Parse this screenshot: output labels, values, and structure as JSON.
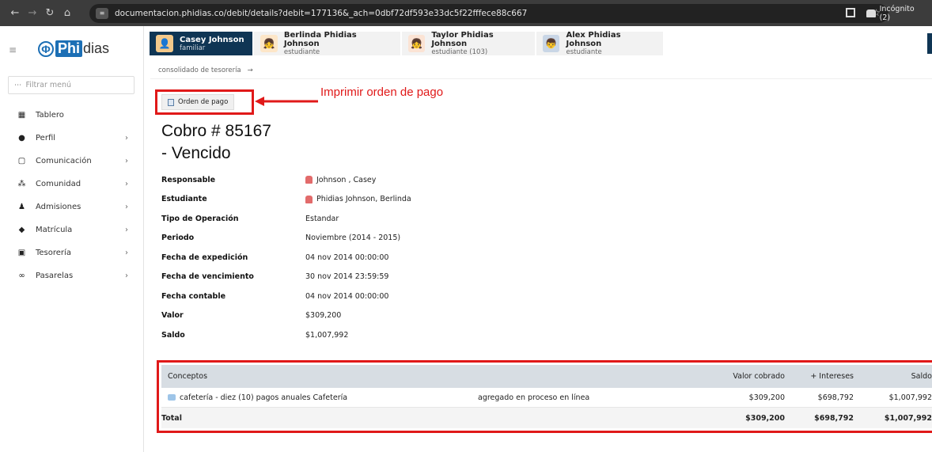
{
  "browser": {
    "url": "documentacion.phidias.co/debit/details?debit=177136&_ach=0dbf72df593e33dc5f22fffece88c667",
    "incognito_label": "Incógnito (2)"
  },
  "sidebar": {
    "logo": {
      "phi": "Phi",
      "dias": "dias"
    },
    "filter_placeholder": "Filtrar menú",
    "items": [
      {
        "label": "Tablero",
        "icon": "dashboard-icon"
      },
      {
        "label": "Perfil",
        "icon": "person-icon"
      },
      {
        "label": "Comunicación",
        "icon": "chat-icon"
      },
      {
        "label": "Comunidad",
        "icon": "group-icon"
      },
      {
        "label": "Admisiones",
        "icon": "admissions-icon"
      },
      {
        "label": "Matrícula",
        "icon": "graduation-cap-icon"
      },
      {
        "label": "Tesorería",
        "icon": "money-icon"
      },
      {
        "label": "Pasarelas",
        "icon": "link-icon"
      }
    ]
  },
  "tabs": [
    {
      "name": "Casey Johnson",
      "role": "familiar"
    },
    {
      "name": "Berlinda Phidias Johnson",
      "role": "estudiante"
    },
    {
      "name": "Taylor Phidias Johnson",
      "role": "estudiante (103)"
    },
    {
      "name": "Alex Phidias Johnson",
      "role": "estudiante"
    }
  ],
  "breadcrumb": {
    "label": "consolidado de tesorería",
    "arrow": "→"
  },
  "orden_button": "Orden de pago",
  "annotation": "Imprimir orden de pago",
  "title": {
    "line1": "Cobro # 85167",
    "line2": "- Vencido"
  },
  "details": [
    {
      "key": "Responsable",
      "value": "Johnson , Casey",
      "person": true
    },
    {
      "key": "Estudiante",
      "value": "Phidias Johnson, Berlinda",
      "person": true
    },
    {
      "key": "Tipo de Operación",
      "value": "Estandar"
    },
    {
      "key": "Periodo",
      "value": "Noviembre (2014 - 2015)"
    },
    {
      "key": "Fecha de expedición",
      "value": "04 nov 2014 00:00:00"
    },
    {
      "key": "Fecha de vencimiento",
      "value": "30 nov 2014 23:59:59"
    },
    {
      "key": "Fecha contable",
      "value": "04 nov 2014 00:00:00"
    },
    {
      "key": "Valor",
      "value": "$309,200"
    },
    {
      "key": "Saldo",
      "value": "$1,007,992"
    }
  ],
  "table": {
    "headers": [
      "Conceptos",
      "",
      "Valor cobrado",
      "+ Intereses",
      "Saldo"
    ],
    "rows": [
      [
        "cafetería - diez (10) pagos anuales Cafetería",
        "agregado en proceso en línea",
        "$309,200",
        "$698,792",
        "$1,007,992"
      ]
    ],
    "total": [
      "Total",
      "",
      "$309,200",
      "$698,792",
      "$1,007,992"
    ]
  }
}
